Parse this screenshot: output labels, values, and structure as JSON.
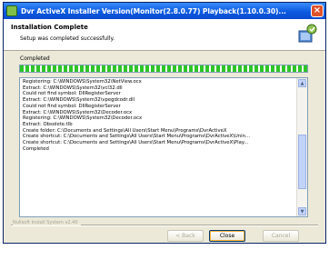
{
  "window": {
    "title": "Dvr ActiveX Installer  Version(Monitor(2.8.0.77) Playback(1.10.0.30)..."
  },
  "header": {
    "title": "Installation Complete",
    "subtitle": "Setup was completed successfully."
  },
  "status": {
    "label": "Completed",
    "progress_percent": 100
  },
  "log": [
    "Registering: C:\\WINDOWS\\System32\\NetView.ocx",
    "Extract: C:\\WINDOWS\\System32\\vcl32.dll",
    "Could not find symbol: DllRegisterServer",
    "Extract: C:\\WINDOWS\\System32\\vpegdcodr.dll",
    "Could not find symbol: DllRegisterServer",
    "Extract: C:\\WINDOWS\\System32\\Decoder.ocx",
    "Registering: C:\\WINDOWS\\System32\\Decoder.ocx",
    "Extract: Obsolete.tlb",
    "Create folder: C:\\Documents and Settings\\All Users\\Start Menu\\Programs\\DvrActiveX",
    "Create shortcut: C:\\Documents and Settings\\All Users\\Start Menu\\Programs\\DvrActiveX\\Unin...",
    "Create shortcut: C:\\Documents and Settings\\All Users\\Start Menu\\Programs\\DvrActiveX\\Play...",
    "Completed"
  ],
  "footer": {
    "brand": "Nullsoft Install System v2.40"
  },
  "buttons": {
    "back": "< Back",
    "close": "Close",
    "cancel": "Cancel"
  },
  "colors": {
    "titlebar": "#0b5ae0",
    "progress": "#2ec526",
    "window_bg": "#ece9d8"
  }
}
